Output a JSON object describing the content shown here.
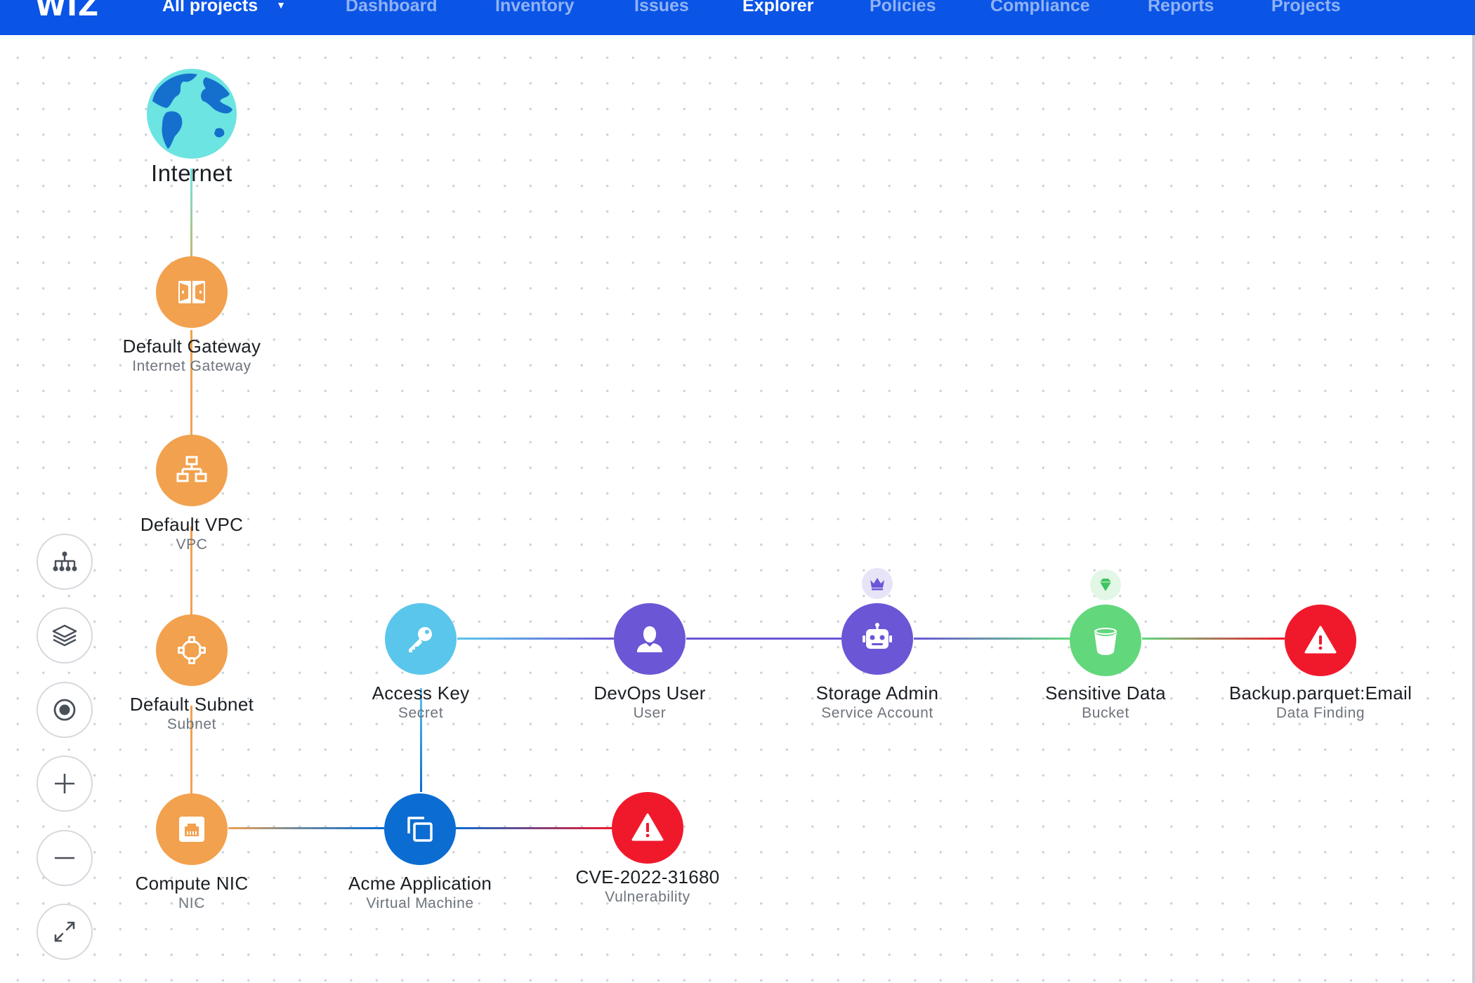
{
  "nav": {
    "logo": "WIZ",
    "project_selector": "All projects",
    "items": [
      "Dashboard",
      "Inventory",
      "Issues",
      "Explorer",
      "Policies",
      "Compliance",
      "Reports",
      "Projects"
    ],
    "active": "Explorer"
  },
  "graph": {
    "internet": {
      "label": "Internet"
    },
    "default_gateway": {
      "label": "Default Gateway",
      "type": "Internet Gateway"
    },
    "default_vpc": {
      "label": "Default VPC",
      "type": "VPC"
    },
    "default_subnet": {
      "label": "Default Subnet",
      "type": "Subnet"
    },
    "compute_nic": {
      "label": "Compute NIC",
      "type": "NIC"
    },
    "acme_application": {
      "label": "Acme Application",
      "type": "Virtual Machine"
    },
    "cve": {
      "label": "CVE-2022-31680",
      "type": "Vulnerability"
    },
    "access_key": {
      "label": "Access Key",
      "type": "Secret"
    },
    "devops_user": {
      "label": "DevOps User",
      "type": "User"
    },
    "storage_admin": {
      "label": "Storage Admin",
      "type": "Service Account",
      "badge": "crown-icon"
    },
    "sensitive_data": {
      "label": "Sensitive Data",
      "type": "Bucket",
      "badge": "gem-icon"
    },
    "backup_finding": {
      "label": "Backup.parquet:Email",
      "type": "Data Finding"
    }
  },
  "toolbar": [
    "hierarchy-layout",
    "layers",
    "focus",
    "zoom-in",
    "zoom-out",
    "fit-to-screen"
  ],
  "colors": {
    "nav_bg": "#0a54e6",
    "network": "#f2a14e",
    "secret": "#5bc6ec",
    "identity": "#6b56d6",
    "bucket": "#62d77c",
    "vm": "#0b6cd1",
    "alert": "#f0192c",
    "globe_water": "#6ce4e2",
    "globe_land": "#1470cc"
  }
}
